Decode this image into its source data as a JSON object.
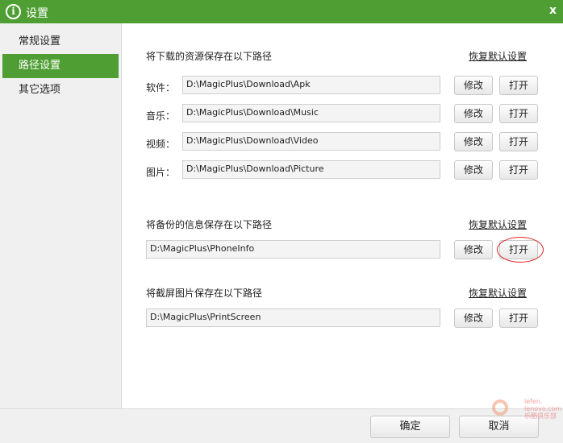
{
  "window": {
    "title": "设置",
    "close": "x"
  },
  "sidebar": {
    "items": [
      {
        "label": "常规设置"
      },
      {
        "label": "路径设置",
        "active": true
      },
      {
        "label": "其它选项"
      }
    ]
  },
  "download": {
    "heading": "将下载的资源保存在以下路径",
    "reset": "恢复默认设置",
    "rows": [
      {
        "label": "软件：",
        "path": "D:\\MagicPlus\\Download\\Apk"
      },
      {
        "label": "音乐：",
        "path": "D:\\MagicPlus\\Download\\Music"
      },
      {
        "label": "视频：",
        "path": "D:\\MagicPlus\\Download\\Video"
      },
      {
        "label": "图片：",
        "path": "D:\\MagicPlus\\Download\\Picture"
      }
    ]
  },
  "backup": {
    "heading": "将备份的信息保存在以下路径",
    "reset": "恢复默认设置",
    "path": "D:\\MagicPlus\\PhoneInfo"
  },
  "screenshot": {
    "heading": "将截屏图片保存在以下路径",
    "reset": "恢复默认设置",
    "path": "D:\\MagicPlus\\PrintScreen"
  },
  "buttons": {
    "modify": "修改",
    "open": "打开",
    "ok": "确定",
    "cancel": "取消"
  },
  "watermark": {
    "line1": "lefen.",
    "line2": "lenovo.com",
    "line3": "乐酷俱乐部"
  },
  "colors": {
    "accent": "#4f9e33",
    "highlight": "#e02020"
  }
}
